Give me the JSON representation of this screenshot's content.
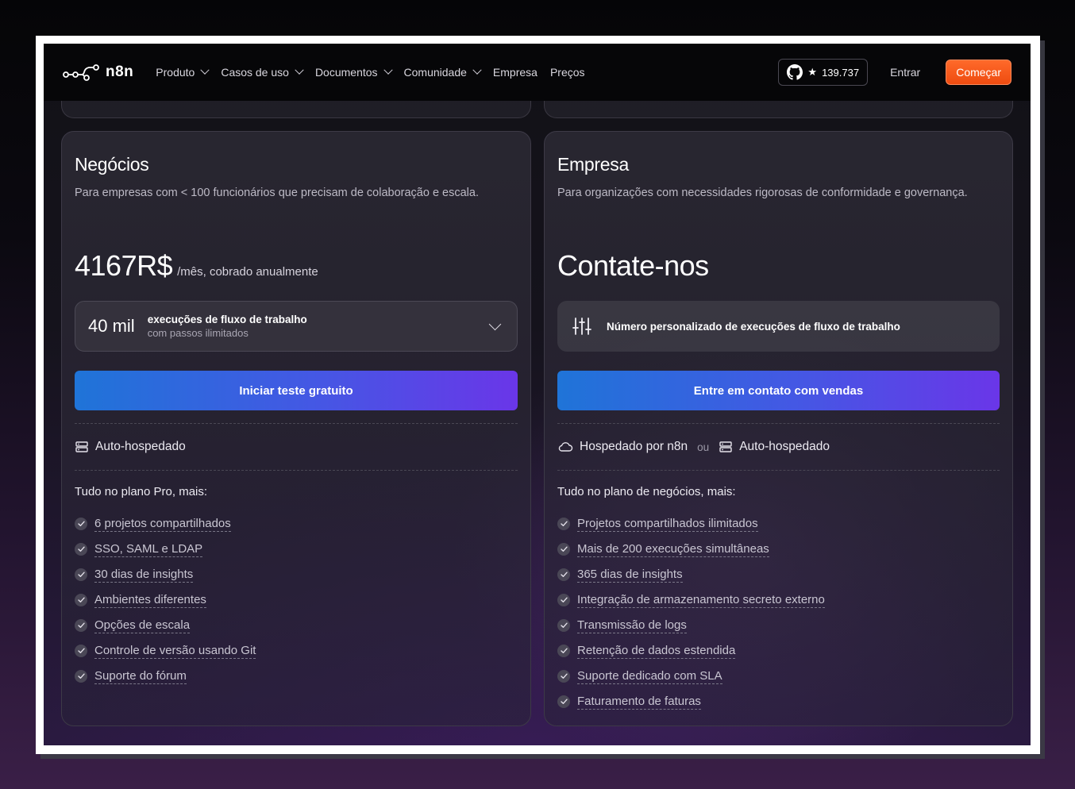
{
  "nav": {
    "logo": "n8n",
    "menu": [
      {
        "label": "Produto",
        "dropdown": true
      },
      {
        "label": "Casos de uso",
        "dropdown": true
      },
      {
        "label": "Documentos",
        "dropdown": true
      },
      {
        "label": "Comunidade",
        "dropdown": true
      },
      {
        "label": "Empresa",
        "dropdown": false
      },
      {
        "label": "Preços",
        "dropdown": false
      }
    ],
    "github_stars": "139.737",
    "signin": "Entrar",
    "cta": "Começar"
  },
  "plans": [
    {
      "name": "Negócios",
      "description": "Para empresas com < 100 funcionários que precisam de colaboração e escala.",
      "price": "4167R$",
      "price_suffix": "/mês, cobrado anualmente",
      "executions": {
        "amount": "40 mil",
        "label": "execuções de fluxo de trabalho",
        "sublabel": "com passos ilimitados"
      },
      "button": "Iniciar teste gratuito",
      "hosting": {
        "self_hosted": "Auto-hospedado"
      },
      "features_intro": "Tudo no plano Pro, mais:",
      "features": [
        "6 projetos compartilhados",
        "SSO, SAML e LDAP",
        "30 dias de insights",
        "Ambientes diferentes",
        "Opções de escala",
        "Controle de versão usando Git",
        "Suporte do fórum"
      ]
    },
    {
      "name": "Empresa",
      "description": "Para organizações com necessidades rigorosas de conformidade e governança.",
      "price": "Contate-nos",
      "executions": {
        "label": "Número personalizado de execuções de fluxo de trabalho"
      },
      "button": "Entre em contato com vendas",
      "hosting": {
        "cloud": "Hospedado por n8n",
        "or": "ou",
        "self_hosted": "Auto-hospedado"
      },
      "features_intro": "Tudo no plano de negócios, mais:",
      "features": [
        "Projetos compartilhados ilimitados",
        "Mais de 200 execuções simultâneas",
        "365 dias de insights",
        "Integração de armazenamento secreto externo",
        "Transmissão de logs",
        "Retenção de dados estendida",
        "Suporte dedicado com SLA",
        "Faturamento de faturas"
      ]
    }
  ]
}
